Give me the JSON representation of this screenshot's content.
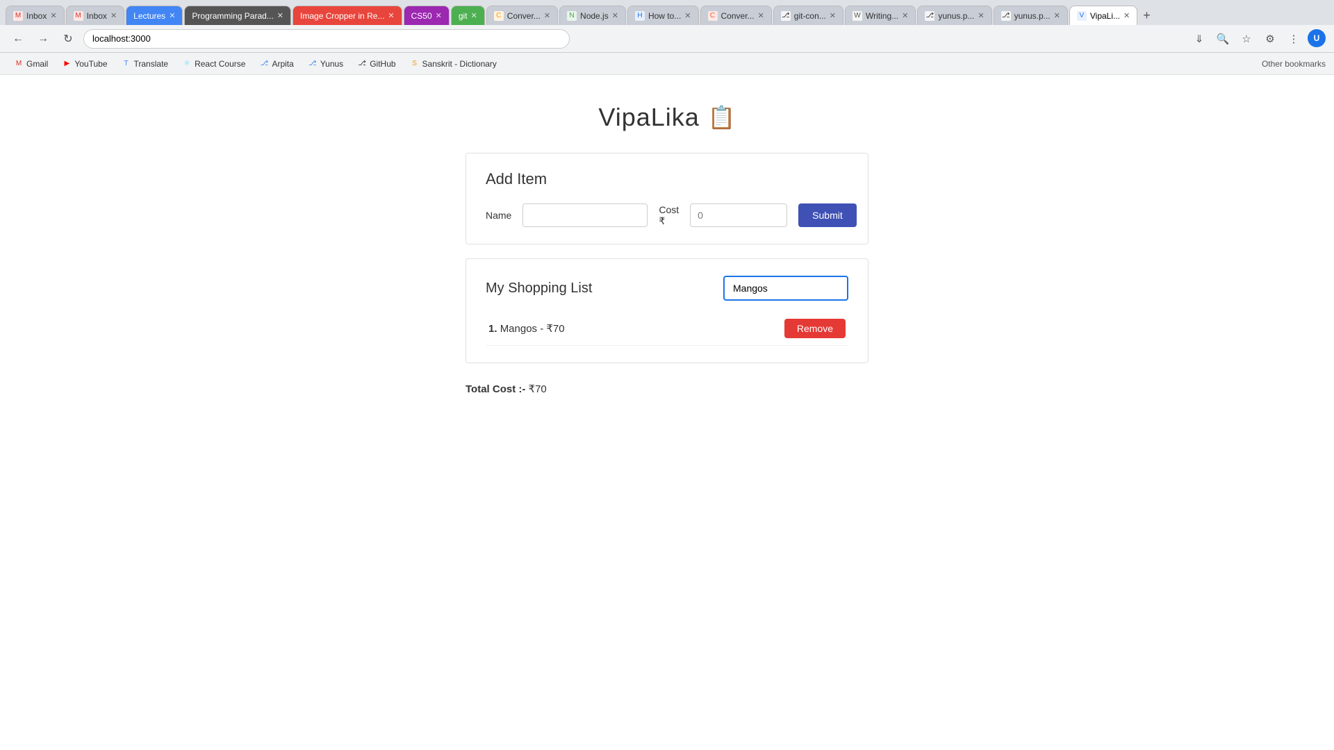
{
  "browser": {
    "address": "localhost:3000",
    "tabs": [
      {
        "id": "inbox1",
        "label": "Inbox",
        "favicon": "M",
        "faviconColor": "#d93025",
        "active": false
      },
      {
        "id": "inbox2",
        "label": "Inbox",
        "favicon": "M",
        "faviconColor": "#d93025",
        "active": false
      },
      {
        "id": "lectures",
        "label": "Lectures",
        "favicon": "L",
        "faviconColor": "#4285f4",
        "active": false,
        "colored": true,
        "bg": "#4285f4"
      },
      {
        "id": "prog",
        "label": "Programming Parad...",
        "favicon": "P",
        "faviconColor": "#555",
        "active": false,
        "colored": true,
        "bg": "#555"
      },
      {
        "id": "imgcrop",
        "label": "Image Cropper in Re...",
        "favicon": "I",
        "faviconColor": "#e8453c",
        "active": false,
        "colored": true,
        "bg": "#e8453c"
      },
      {
        "id": "css50",
        "label": "CS50",
        "favicon": "C",
        "faviconColor": "#9c27b0",
        "active": false,
        "colored": true,
        "bg": "#9c27b0"
      },
      {
        "id": "git",
        "label": "git",
        "favicon": "g",
        "faviconColor": "#4caf50",
        "active": false,
        "colored": true,
        "bg": "#4caf50"
      },
      {
        "id": "conv1",
        "label": "Conver...",
        "favicon": "C",
        "faviconColor": "#ff9800",
        "active": false
      },
      {
        "id": "nodejs",
        "label": "Node.js",
        "favicon": "N",
        "faviconColor": "#43a047",
        "active": false
      },
      {
        "id": "howto",
        "label": "How to...",
        "favicon": "H",
        "faviconColor": "#1a73e8",
        "active": false
      },
      {
        "id": "conv2",
        "label": "Conver...",
        "favicon": "C",
        "faviconColor": "#ff5722",
        "active": false
      },
      {
        "id": "gitcon",
        "label": "git-con...",
        "favicon": "G",
        "faviconColor": "#333",
        "active": false
      },
      {
        "id": "writing",
        "label": "Writing...",
        "favicon": "W",
        "faviconColor": "#555",
        "active": false
      },
      {
        "id": "yunus1",
        "label": "yunus.p...",
        "favicon": "Y",
        "faviconColor": "#333",
        "active": false
      },
      {
        "id": "yunus2",
        "label": "yunus.p...",
        "favicon": "Y",
        "faviconColor": "#333",
        "active": false
      },
      {
        "id": "vipalika",
        "label": "VipaLi...",
        "favicon": "V",
        "faviconColor": "#1a73e8",
        "active": true
      }
    ],
    "bookmarks": [
      {
        "label": "Gmail",
        "favicon": "G",
        "faviconColor": "#d93025"
      },
      {
        "label": "YouTube",
        "favicon": "▶",
        "faviconColor": "#ff0000"
      },
      {
        "label": "Translate",
        "favicon": "T",
        "faviconColor": "#4285f4"
      },
      {
        "label": "React Course",
        "favicon": "⚛",
        "faviconColor": "#61dafb"
      },
      {
        "label": "Arpita",
        "favicon": "A",
        "faviconColor": "#4285f4"
      },
      {
        "label": "Yunus",
        "favicon": "Y",
        "faviconColor": "#4285f4"
      },
      {
        "label": "GitHub",
        "favicon": "⎇",
        "faviconColor": "#333"
      },
      {
        "label": "Sanskrit - Dictionary",
        "favicon": "S",
        "faviconColor": "#ff9800"
      }
    ],
    "bookmarks_right": "Other bookmarks"
  },
  "app": {
    "title": "VipaLika",
    "icon": "📋",
    "add_item": {
      "section_title": "Add Item",
      "name_label": "Name",
      "name_placeholder": "",
      "cost_label": "Cost ₹",
      "cost_placeholder": "0",
      "submit_label": "Submit"
    },
    "shopping_list": {
      "section_title": "My Shopping List",
      "search_value": "Mangos",
      "items": [
        {
          "number": 1,
          "name": "Mangos",
          "cost": "₹70"
        }
      ],
      "remove_label": "Remove"
    },
    "total_cost": {
      "label": "Total Cost :-",
      "value": "₹70"
    }
  }
}
